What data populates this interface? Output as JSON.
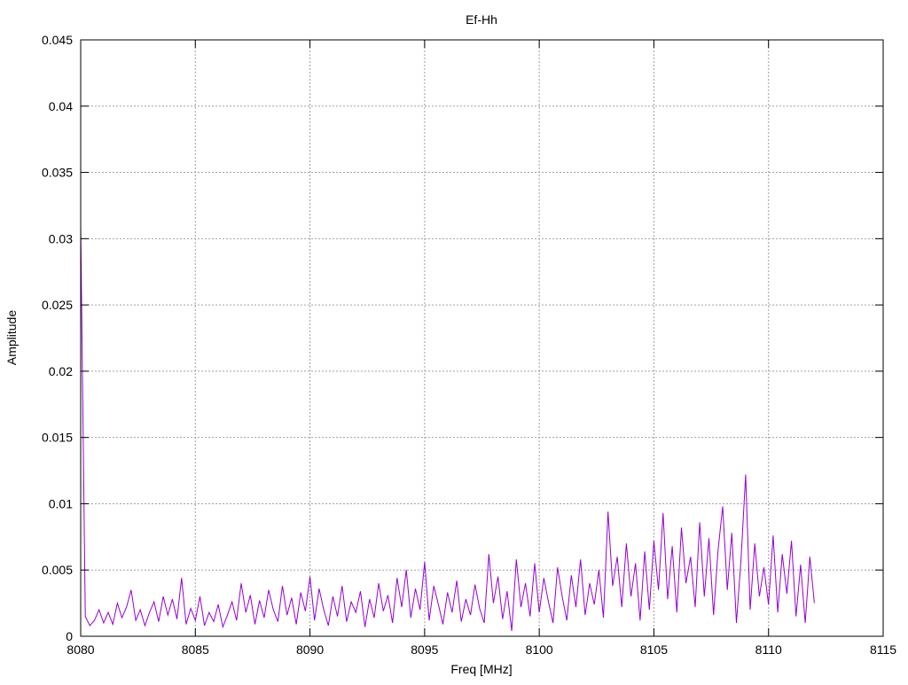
{
  "chart_data": {
    "type": "line",
    "title": "Ef-Hh",
    "xlabel": "Freq [MHz]",
    "ylabel": "Amplitude",
    "xlim": [
      8080,
      8115
    ],
    "ylim": [
      0,
      0.045
    ],
    "grid": true,
    "x_ticks": [
      "8080",
      "8085",
      "8090",
      "8095",
      "8100",
      "8105",
      "8110",
      "8115"
    ],
    "x_tick_values": [
      8080,
      8085,
      8090,
      8095,
      8100,
      8105,
      8110,
      8115
    ],
    "y_ticks": [
      "0",
      "0.005",
      "0.01",
      "0.015",
      "0.02",
      "0.025",
      "0.03",
      "0.035",
      "0.04",
      "0.045"
    ],
    "y_tick_values": [
      0,
      0.005,
      0.01,
      0.015,
      0.02,
      0.025,
      0.03,
      0.035,
      0.04,
      0.045
    ],
    "series": [
      {
        "name": "Ef-Hh",
        "color": "#9400d3",
        "x_start": 8080,
        "x_step": 0.2,
        "values": [
          0.031,
          0.0015,
          0.0008,
          0.0012,
          0.002,
          0.001,
          0.0018,
          0.0009,
          0.0025,
          0.0014,
          0.0022,
          0.0035,
          0.0012,
          0.002,
          0.0008,
          0.0018,
          0.0026,
          0.0011,
          0.003,
          0.0016,
          0.0028,
          0.0013,
          0.0044,
          0.0009,
          0.0021,
          0.0012,
          0.003,
          0.0008,
          0.0018,
          0.0011,
          0.0024,
          0.0007,
          0.0016,
          0.0026,
          0.0012,
          0.004,
          0.0018,
          0.0031,
          0.0009,
          0.0027,
          0.0014,
          0.0035,
          0.002,
          0.0011,
          0.0038,
          0.0016,
          0.0029,
          0.0009,
          0.0033,
          0.0019,
          0.0045,
          0.0012,
          0.0036,
          0.002,
          0.0008,
          0.003,
          0.0015,
          0.0038,
          0.0011,
          0.0026,
          0.0018,
          0.0034,
          0.0007,
          0.0028,
          0.0014,
          0.004,
          0.0019,
          0.0031,
          0.001,
          0.0044,
          0.0022,
          0.005,
          0.0014,
          0.0036,
          0.002,
          0.0056,
          0.0012,
          0.0038,
          0.0024,
          0.0009,
          0.0033,
          0.0018,
          0.0042,
          0.0011,
          0.0028,
          0.0016,
          0.0039,
          0.0021,
          0.001,
          0.0062,
          0.0025,
          0.0045,
          0.0013,
          0.0034,
          0.0004,
          0.0058,
          0.0022,
          0.004,
          0.0015,
          0.0055,
          0.0018,
          0.0044,
          0.0026,
          0.001,
          0.0052,
          0.003,
          0.0012,
          0.0046,
          0.0022,
          0.0058,
          0.0016,
          0.004,
          0.0024,
          0.005,
          0.0014,
          0.0094,
          0.0038,
          0.006,
          0.0022,
          0.007,
          0.003,
          0.0055,
          0.0012,
          0.0064,
          0.002,
          0.0072,
          0.0035,
          0.0093,
          0.0028,
          0.0068,
          0.0018,
          0.0082,
          0.004,
          0.006,
          0.0022,
          0.0086,
          0.003,
          0.0074,
          0.0016,
          0.0065,
          0.0098,
          0.0035,
          0.0078,
          0.001,
          0.0058,
          0.0122,
          0.002,
          0.007,
          0.003,
          0.0052,
          0.0024,
          0.0076,
          0.0018,
          0.0062,
          0.0032,
          0.0072,
          0.0015,
          0.0054,
          0.001,
          0.006,
          0.0025
        ]
      }
    ]
  }
}
